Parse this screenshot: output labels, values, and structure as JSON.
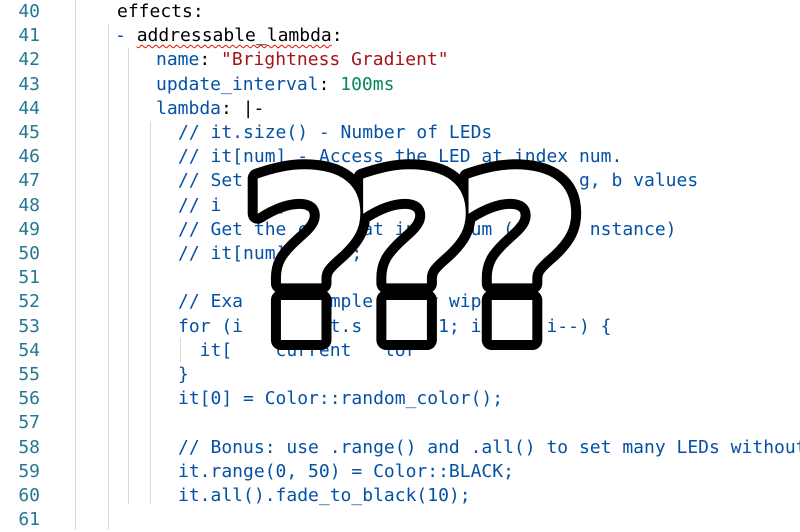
{
  "gutter": {
    "line_numbers": [
      "40",
      "41",
      "42",
      "43",
      "44",
      "45",
      "46",
      "47",
      "48",
      "49",
      "50",
      "51",
      "52",
      "53",
      "54",
      "55",
      "56",
      "57",
      "58",
      "59",
      "60",
      "61"
    ]
  },
  "code": {
    "l40": "effects:",
    "l41_dash": "- ",
    "l41_key": "addressable_lambda",
    "l41_colon": ":",
    "l42_key": "name",
    "l42_rest": ": ",
    "l42_val": "\"Brightness Gradient\"",
    "l43_key": "update_interval",
    "l43_rest": ": ",
    "l43_val": "100ms",
    "l44_key": "lambda",
    "l44_rest": ": |-",
    "l45": "// it.size() - Number of LEDs",
    "l46": "// it[num] - Access the LED at index num.",
    "l47": "// Set    LED at     to the       r, g, b values",
    "l48": "// i    n]     o         )",
    "l49": "// Get the c   r at ind   num (Col    nstance)",
    "l50": "// it[num]     );",
    "l52": "// Exa    : Simple   lor wipe",
    "l53": "for (i   i = it.s   ) - 1; i   0; i--) {",
    "l54": "  it[    current   lor",
    "l55": "}",
    "l56": "it[0] = Color::random_color();",
    "l58": "// Bonus: use .range() and .all() to set many LEDs without",
    "l59": "it.range(0, 50) = Color::BLACK;",
    "l60": "it.all().fade_to_black(10);"
  },
  "overlay": {
    "glyph": "???",
    "fill": "#ffffff",
    "stroke": "#000000"
  }
}
